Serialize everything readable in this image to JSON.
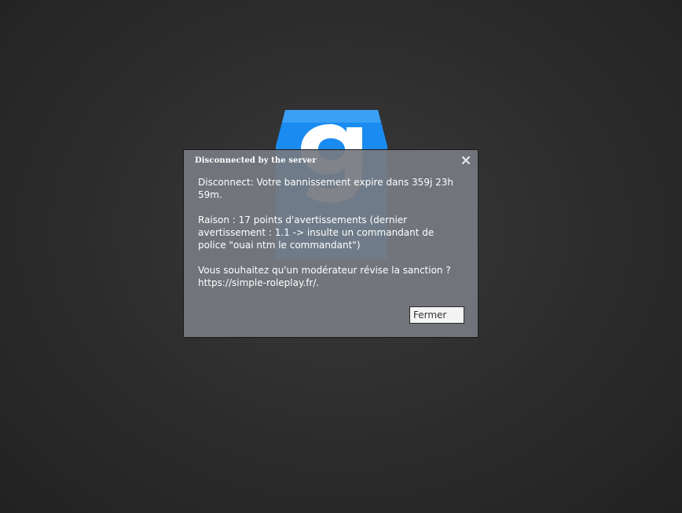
{
  "dialog": {
    "title": "Disconnected by the server",
    "close_icon": "close-icon",
    "message": {
      "line1": "Disconnect: Votre bannissement expire dans 359j 23h 59m.",
      "line2": "Raison : 17 points d'avertissements (dernier avertissement : 1.1 -> insulte un commandant de police \"ouai ntm le commandant\")",
      "line3": "Vous souhaitez qu'un modérateur révise la sanction ? https://simple-roleplay.fr/."
    },
    "button_label": "Fermer"
  },
  "logo": {
    "icon": "gmod-logo-icon",
    "color": "#1a8bf0"
  }
}
